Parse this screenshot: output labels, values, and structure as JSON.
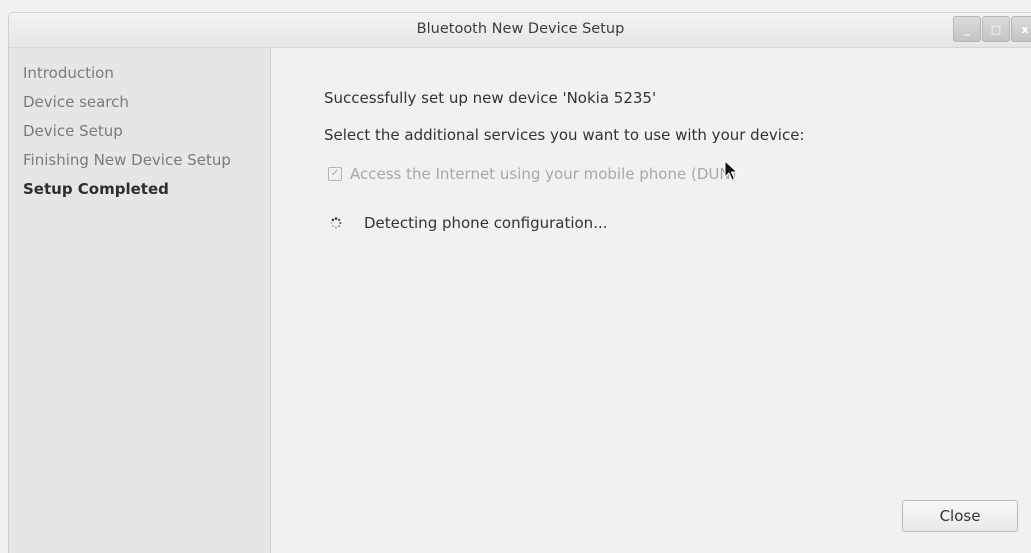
{
  "window": {
    "title": "Bluetooth New Device Setup",
    "controls": {
      "minimize": "_",
      "maximize": "□",
      "close": "x"
    }
  },
  "sidebar": {
    "steps": [
      {
        "label": "Introduction",
        "active": false
      },
      {
        "label": "Device search",
        "active": false
      },
      {
        "label": "Device Setup",
        "active": false
      },
      {
        "label": "Finishing New Device Setup",
        "active": false
      },
      {
        "label": "Setup Completed",
        "active": true
      }
    ]
  },
  "main": {
    "success_message": "Successfully set up new device 'Nokia 5235'",
    "services_prompt": "Select the additional services you want to use with your device:",
    "service_option": {
      "label": "Access the Internet using your mobile phone (DUN)",
      "checked": true,
      "enabled": false
    },
    "status_text": "Detecting phone configuration..."
  },
  "footer": {
    "close_label": "Close"
  },
  "icons": {
    "checkbox": "checkbox-icon",
    "spinner": "spinner-icon",
    "cursor": "mouse-pointer-icon"
  }
}
